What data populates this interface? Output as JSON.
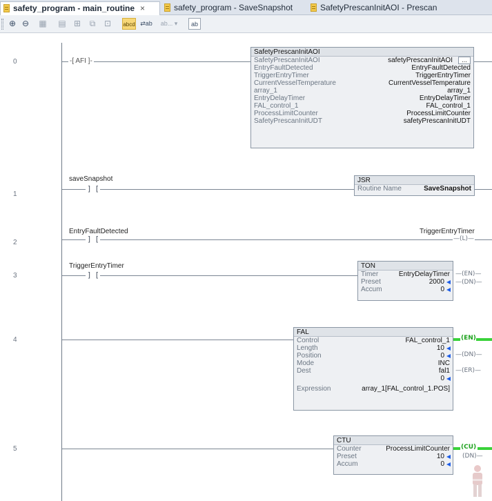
{
  "tabs": [
    {
      "label": "safety_program - main_routine",
      "close": "×",
      "active": true
    },
    {
      "label": "safety_program - SaveSnapshot",
      "active": false
    },
    {
      "label": "SafetyPrescanInitAOI - Prescan",
      "active": false
    }
  ],
  "toolbar": {
    "zoom_in": "⊕",
    "zoom_out": "⊖",
    "abcd": "abcd",
    "ab_dropdown": "ab... ▾",
    "ab_sym": "⇄ab",
    "search_tag": "ab"
  },
  "rungs": [
    {
      "number": "0",
      "afi": "AFI",
      "aoi": {
        "name": "SafetyPrescanInitAOI",
        "ellipsis": "...",
        "rows": [
          {
            "label": "SafetyPrescanInitAOI",
            "value": "safetyPrescanInitAOI"
          },
          {
            "label": "EntryFaultDetected",
            "value": "EntryFaultDetected"
          },
          {
            "label": "TriggerEntryTimer",
            "value": "TriggerEntryTimer"
          },
          {
            "label": "CurrentVesselTemperature",
            "value": "CurrentVesselTemperature"
          },
          {
            "label": "array_1",
            "value": "array_1"
          },
          {
            "label": "EntryDelayTimer",
            "value": "EntryDelayTimer"
          },
          {
            "label": "FAL_control_1",
            "value": "FAL_control_1"
          },
          {
            "label": "ProcessLimitCounter",
            "value": "ProcessLimitCounter"
          },
          {
            "label": "SafetyPrescanInitUDT",
            "value": "safetyPrescanInitUDT"
          }
        ]
      }
    },
    {
      "number": "1",
      "contact_tag": "saveSnapshot",
      "jsr": {
        "name": "JSR",
        "label": "Routine Name",
        "value": "SaveSnapshot"
      }
    },
    {
      "number": "2",
      "contact_tag": "EntryFaultDetected",
      "coil_tag": "TriggerEntryTimer",
      "coil": "—(L)—"
    },
    {
      "number": "3",
      "contact_tag": "TriggerEntryTimer",
      "ton": {
        "name": "TON",
        "rows": [
          {
            "label": "Timer",
            "value": "EntryDelayTimer"
          },
          {
            "label": "Preset",
            "value": "2000"
          },
          {
            "label": "Accum",
            "value": "0"
          }
        ],
        "outputs": [
          "—(EN)—",
          "—(DN)—"
        ]
      }
    },
    {
      "number": "4",
      "fal": {
        "name": "FAL",
        "rows": [
          {
            "label": "Control",
            "value": "FAL_control_1"
          },
          {
            "label": "Length",
            "value": "10"
          },
          {
            "label": "Position",
            "value": "0"
          },
          {
            "label": "Mode",
            "value": "INC"
          },
          {
            "label": "Dest",
            "value": "fal1"
          },
          {
            "label": "",
            "value": "0"
          },
          {
            "label": "Expression",
            "value": "array_1[FAL_control_1.POS]"
          }
        ],
        "outputs": [
          "(EN)",
          "—(DN)—",
          "—(ER)—"
        ]
      }
    },
    {
      "number": "5",
      "ctu": {
        "name": "CTU",
        "rows": [
          {
            "label": "Counter",
            "value": "ProcessLimitCounter"
          },
          {
            "label": "Preset",
            "value": "10"
          },
          {
            "label": "Accum",
            "value": "0"
          }
        ],
        "outputs": [
          "(CU)",
          "(DN)—"
        ]
      }
    }
  ],
  "colors": {
    "energized": "#3ad23a",
    "arrow": "#1d5ee8",
    "tab_icon": "#f2c84b"
  }
}
